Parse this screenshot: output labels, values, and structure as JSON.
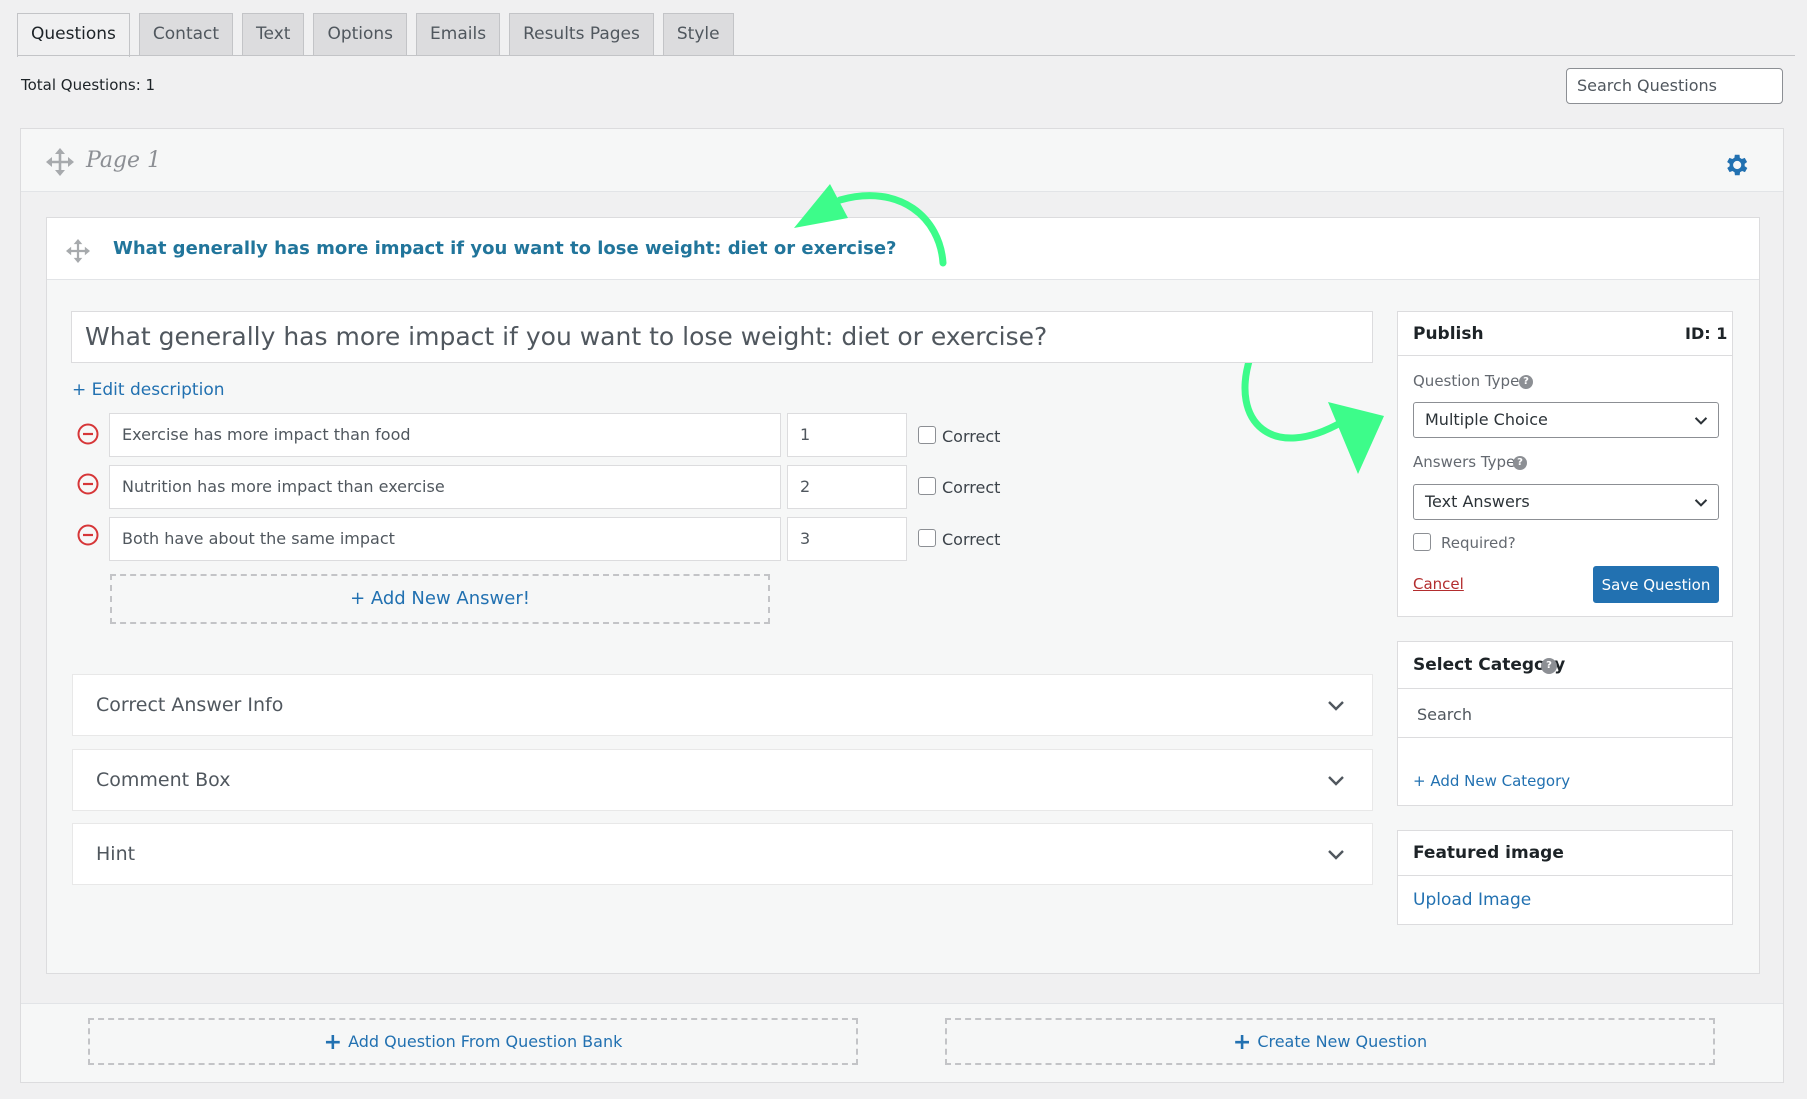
{
  "tabs": [
    {
      "label": "Questions",
      "active": true
    },
    {
      "label": "Contact"
    },
    {
      "label": "Text"
    },
    {
      "label": "Options"
    },
    {
      "label": "Emails"
    },
    {
      "label": "Results Pages"
    },
    {
      "label": "Style"
    }
  ],
  "toolbar": {
    "total_label": "Total Questions:",
    "total_value": "1",
    "search_placeholder": "Search Questions"
  },
  "page": {
    "title": "Page 1"
  },
  "question": {
    "header_title": "What generally has more impact if you want to lose weight: diet or exercise?",
    "input_value": "What generally has more impact if you want to lose weight: diet or exercise?",
    "edit_description": "+ Edit description",
    "answers": [
      {
        "text": "Exercise has more impact than food",
        "points": "1",
        "correct_label": "Correct"
      },
      {
        "text": "Nutrition has more impact than exercise",
        "points": "2",
        "correct_label": "Correct"
      },
      {
        "text": "Both have about the same impact",
        "points": "3",
        "correct_label": "Correct"
      }
    ],
    "add_answer": "+ Add New Answer!",
    "accordions": [
      "Correct Answer Info",
      "Comment Box",
      "Hint"
    ]
  },
  "publish": {
    "title": "Publish",
    "id_label": "ID: 1",
    "question_type_label": "Question Type",
    "question_type_value": "Multiple Choice",
    "answers_type_label": "Answers Type",
    "answers_type_value": "Text Answers",
    "required_label": "Required?",
    "cancel": "Cancel",
    "save": "Save Question"
  },
  "category": {
    "title": "Select Category",
    "search_placeholder": "Search",
    "add_new": "+ Add New Category"
  },
  "featured": {
    "title": "Featured image",
    "upload": "Upload Image"
  },
  "bottom": {
    "from_bank": "Add Question From Question Bank",
    "create_new": "Create New Question"
  },
  "colors": {
    "accent": "#2271b1",
    "annotation_arrow": "#3dfc8a",
    "remove": "#d63638"
  }
}
